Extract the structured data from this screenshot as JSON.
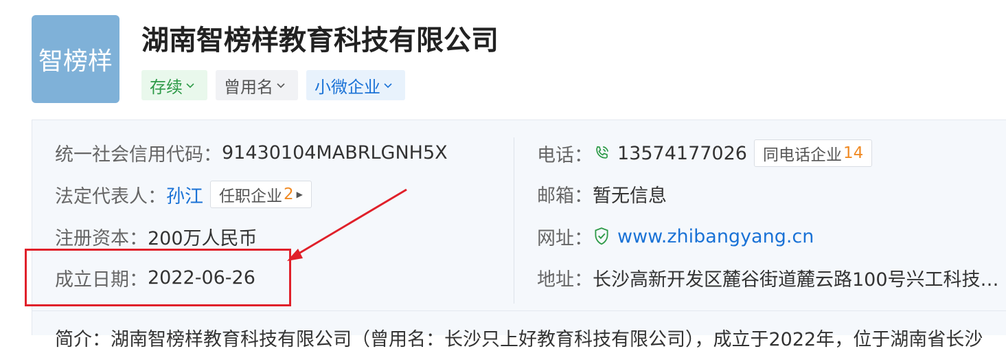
{
  "company": {
    "logo_text": "智榜样",
    "name": "湖南智榜样教育科技有限公司",
    "tags": {
      "status": "存续",
      "former_name": "曾用名",
      "size": "小微企业"
    }
  },
  "info": {
    "credit_code": {
      "label": "统一社会信用代码：",
      "value": "91430104MABRLGNH5X"
    },
    "legal_rep": {
      "label": "法定代表人：",
      "value": "孙江",
      "pill_label": "任职企业",
      "pill_count": "2"
    },
    "capital": {
      "label": "注册资本：",
      "value": "200万人民币"
    },
    "founded": {
      "label": "成立日期：",
      "value": "2022-06-26"
    },
    "phone": {
      "label": "电话：",
      "value": "13574177026",
      "pill_label": "同电话企业",
      "pill_count": "14"
    },
    "email": {
      "label": "邮箱：",
      "value": "暂无信息"
    },
    "website": {
      "label": "网址：",
      "value": "www.zhibangyang.cn"
    },
    "address": {
      "label": "地址：",
      "value": "长沙高新开发区麓谷街道麓云路100号兴工科技…"
    }
  },
  "intro": "简介：湖南智榜样教育科技有限公司（曾用名：长沙只上好教育科技有限公司），成立于2022年，位于湖南省长沙",
  "colors": {
    "accent_blue": "#1a72d6",
    "status_green": "#2e9a48",
    "count_orange": "#f08a24",
    "highlight_red": "#e0202a",
    "logo_bg": "#7fb1d8"
  },
  "icons": {
    "phone": "phone-icon",
    "website": "shield-check-icon",
    "chevron": "chevron-down-icon"
  }
}
